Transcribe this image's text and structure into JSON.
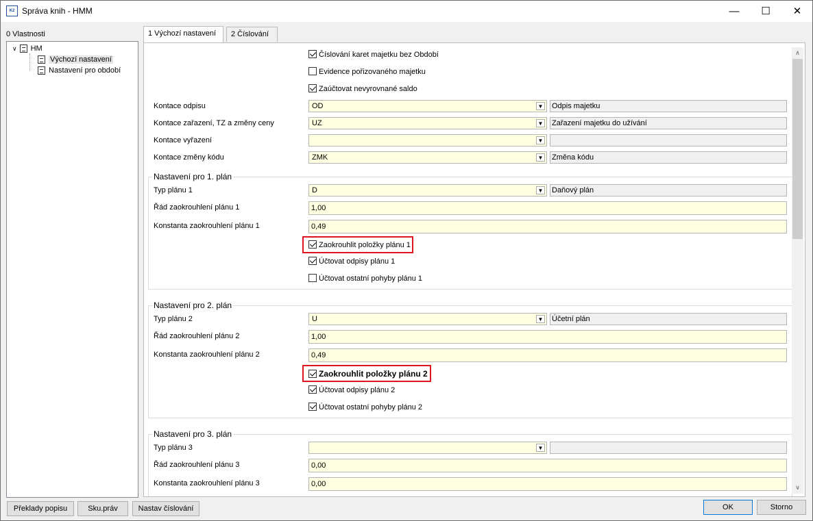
{
  "window": {
    "title": "Správa knih - HMM",
    "app_icon_text": "K2"
  },
  "left": {
    "tab_label": "0 Vlastnosti",
    "tree": {
      "root": "HM",
      "child1": "Výchozí nastavení",
      "child2": "Nastavení pro období"
    }
  },
  "tabs": {
    "tab1": "1 Výchozí nastavení",
    "tab2": "2 Číslování"
  },
  "main": {
    "chk1": "Číslování karet majetku bez Období",
    "chk2": "Evidence pořizovaného majetku",
    "chk3": "Zaúčtovat nevyrovnané saldo",
    "kontace_odpisu": {
      "label": "Kontace odpisu",
      "value": "OD",
      "desc": "Odpis majetku"
    },
    "kontace_zarazeni": {
      "label": "Kontace zařazení, TZ a změny ceny",
      "value": "UZ",
      "desc": "Zařazení majetku do užívání"
    },
    "kontace_vyrazeni": {
      "label": "Kontace vyřazení",
      "value": "",
      "desc": ""
    },
    "kontace_zmeny": {
      "label": "Kontace změny kódu",
      "value": "ZMK",
      "desc": "Změna kódu"
    }
  },
  "plan1": {
    "title": "Nastavení pro 1. plán",
    "typ_label": "Typ plánu 1",
    "typ_value": "D",
    "typ_desc": "Daňový plán",
    "rad_label": "Řád zaokrouhlení plánu 1",
    "rad_value": "1,00",
    "konst_label": "Konstanta zaokrouhlení plánu 1",
    "konst_value": "0,49",
    "chk_zaokr": "Zaokrouhlit položky plánu 1",
    "chk_odpisy": "Účtovat odpisy plánu 1",
    "chk_ostatni": "Účtovat ostatní pohyby plánu 1"
  },
  "plan2": {
    "title": "Nastavení pro 2. plán",
    "typ_label": "Typ plánu 2",
    "typ_value": "U",
    "typ_desc": "Účetní plán",
    "rad_label": "Řád zaokrouhlení plánu 2",
    "rad_value": "1,00",
    "konst_label": "Konstanta zaokrouhlení plánu 2",
    "konst_value": "0,49",
    "chk_zaokr": "Zaokrouhlit položky plánu 2",
    "chk_odpisy": "Účtovat odpisy plánu 2",
    "chk_ostatni": "Účtovat ostatní pohyby plánu 2"
  },
  "plan3": {
    "title": "Nastavení pro 3. plán",
    "typ_label": "Typ plánu 3",
    "typ_value": "",
    "typ_desc": "",
    "rad_label": "Řád zaokrouhlení plánu 3",
    "rad_value": "0,00",
    "konst_label": "Konstanta zaokrouhlení plánu 3",
    "konst_value": "0,00"
  },
  "buttons": {
    "preklady": "Překlady popisu",
    "sku": "Sku.práv",
    "nastav": "Nastav číslování",
    "ok": "OK",
    "storno": "Storno"
  },
  "colors": {
    "input_bg": "#ffffe1",
    "highlight_border": "#e0141e",
    "accent": "#0078d7"
  }
}
